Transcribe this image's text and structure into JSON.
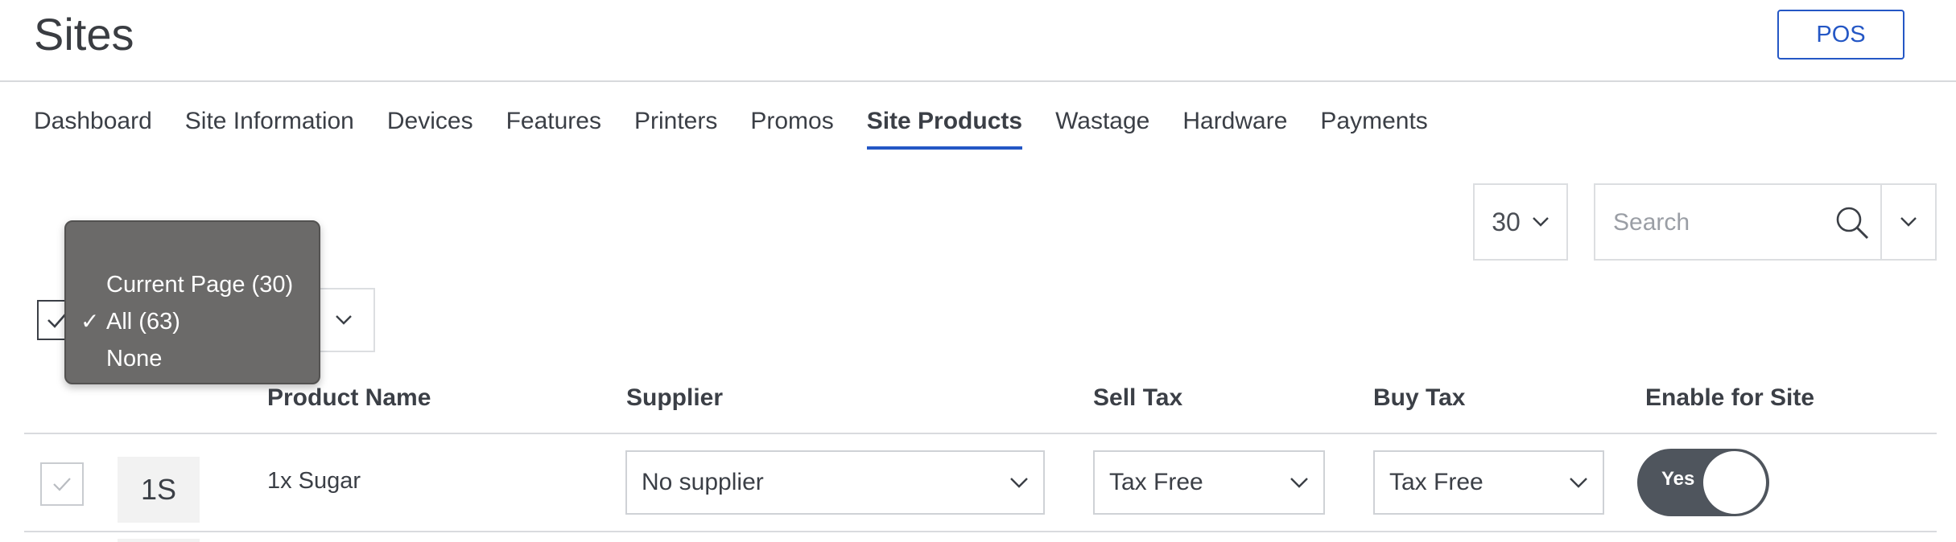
{
  "header": {
    "title": "Sites",
    "pos_button": "POS"
  },
  "tabs": [
    {
      "label": "Dashboard",
      "active": false
    },
    {
      "label": "Site Information",
      "active": false
    },
    {
      "label": "Devices",
      "active": false
    },
    {
      "label": "Features",
      "active": false
    },
    {
      "label": "Printers",
      "active": false
    },
    {
      "label": "Promos",
      "active": false
    },
    {
      "label": "Site Products",
      "active": true
    },
    {
      "label": "Wastage",
      "active": false
    },
    {
      "label": "Hardware",
      "active": false
    },
    {
      "label": "Payments",
      "active": false
    }
  ],
  "toolbar": {
    "per_page": "30",
    "search_placeholder": "Search"
  },
  "select_menu": {
    "items": [
      {
        "label": "Current Page (30)",
        "checked": false
      },
      {
        "label": "All (63)",
        "checked": true
      },
      {
        "label": "None",
        "checked": false
      }
    ],
    "check_glyph": "✓"
  },
  "table": {
    "columns": [
      "Product Name",
      "Supplier",
      "Sell Tax",
      "Buy Tax",
      "Enable for Site"
    ],
    "rows": [
      {
        "avatar": "1S",
        "product_name": "1x Sugar",
        "supplier": "No supplier",
        "sell_tax": "Tax Free",
        "buy_tax": "Tax Free",
        "enabled_label": "Yes",
        "enabled": true
      }
    ]
  },
  "colors": {
    "accent": "#2457c5",
    "menu_bg": "#6b6a69",
    "toggle_bg": "#4f555d"
  },
  "icons": [
    "search-icon",
    "chevron-down-icon",
    "check-icon"
  ]
}
